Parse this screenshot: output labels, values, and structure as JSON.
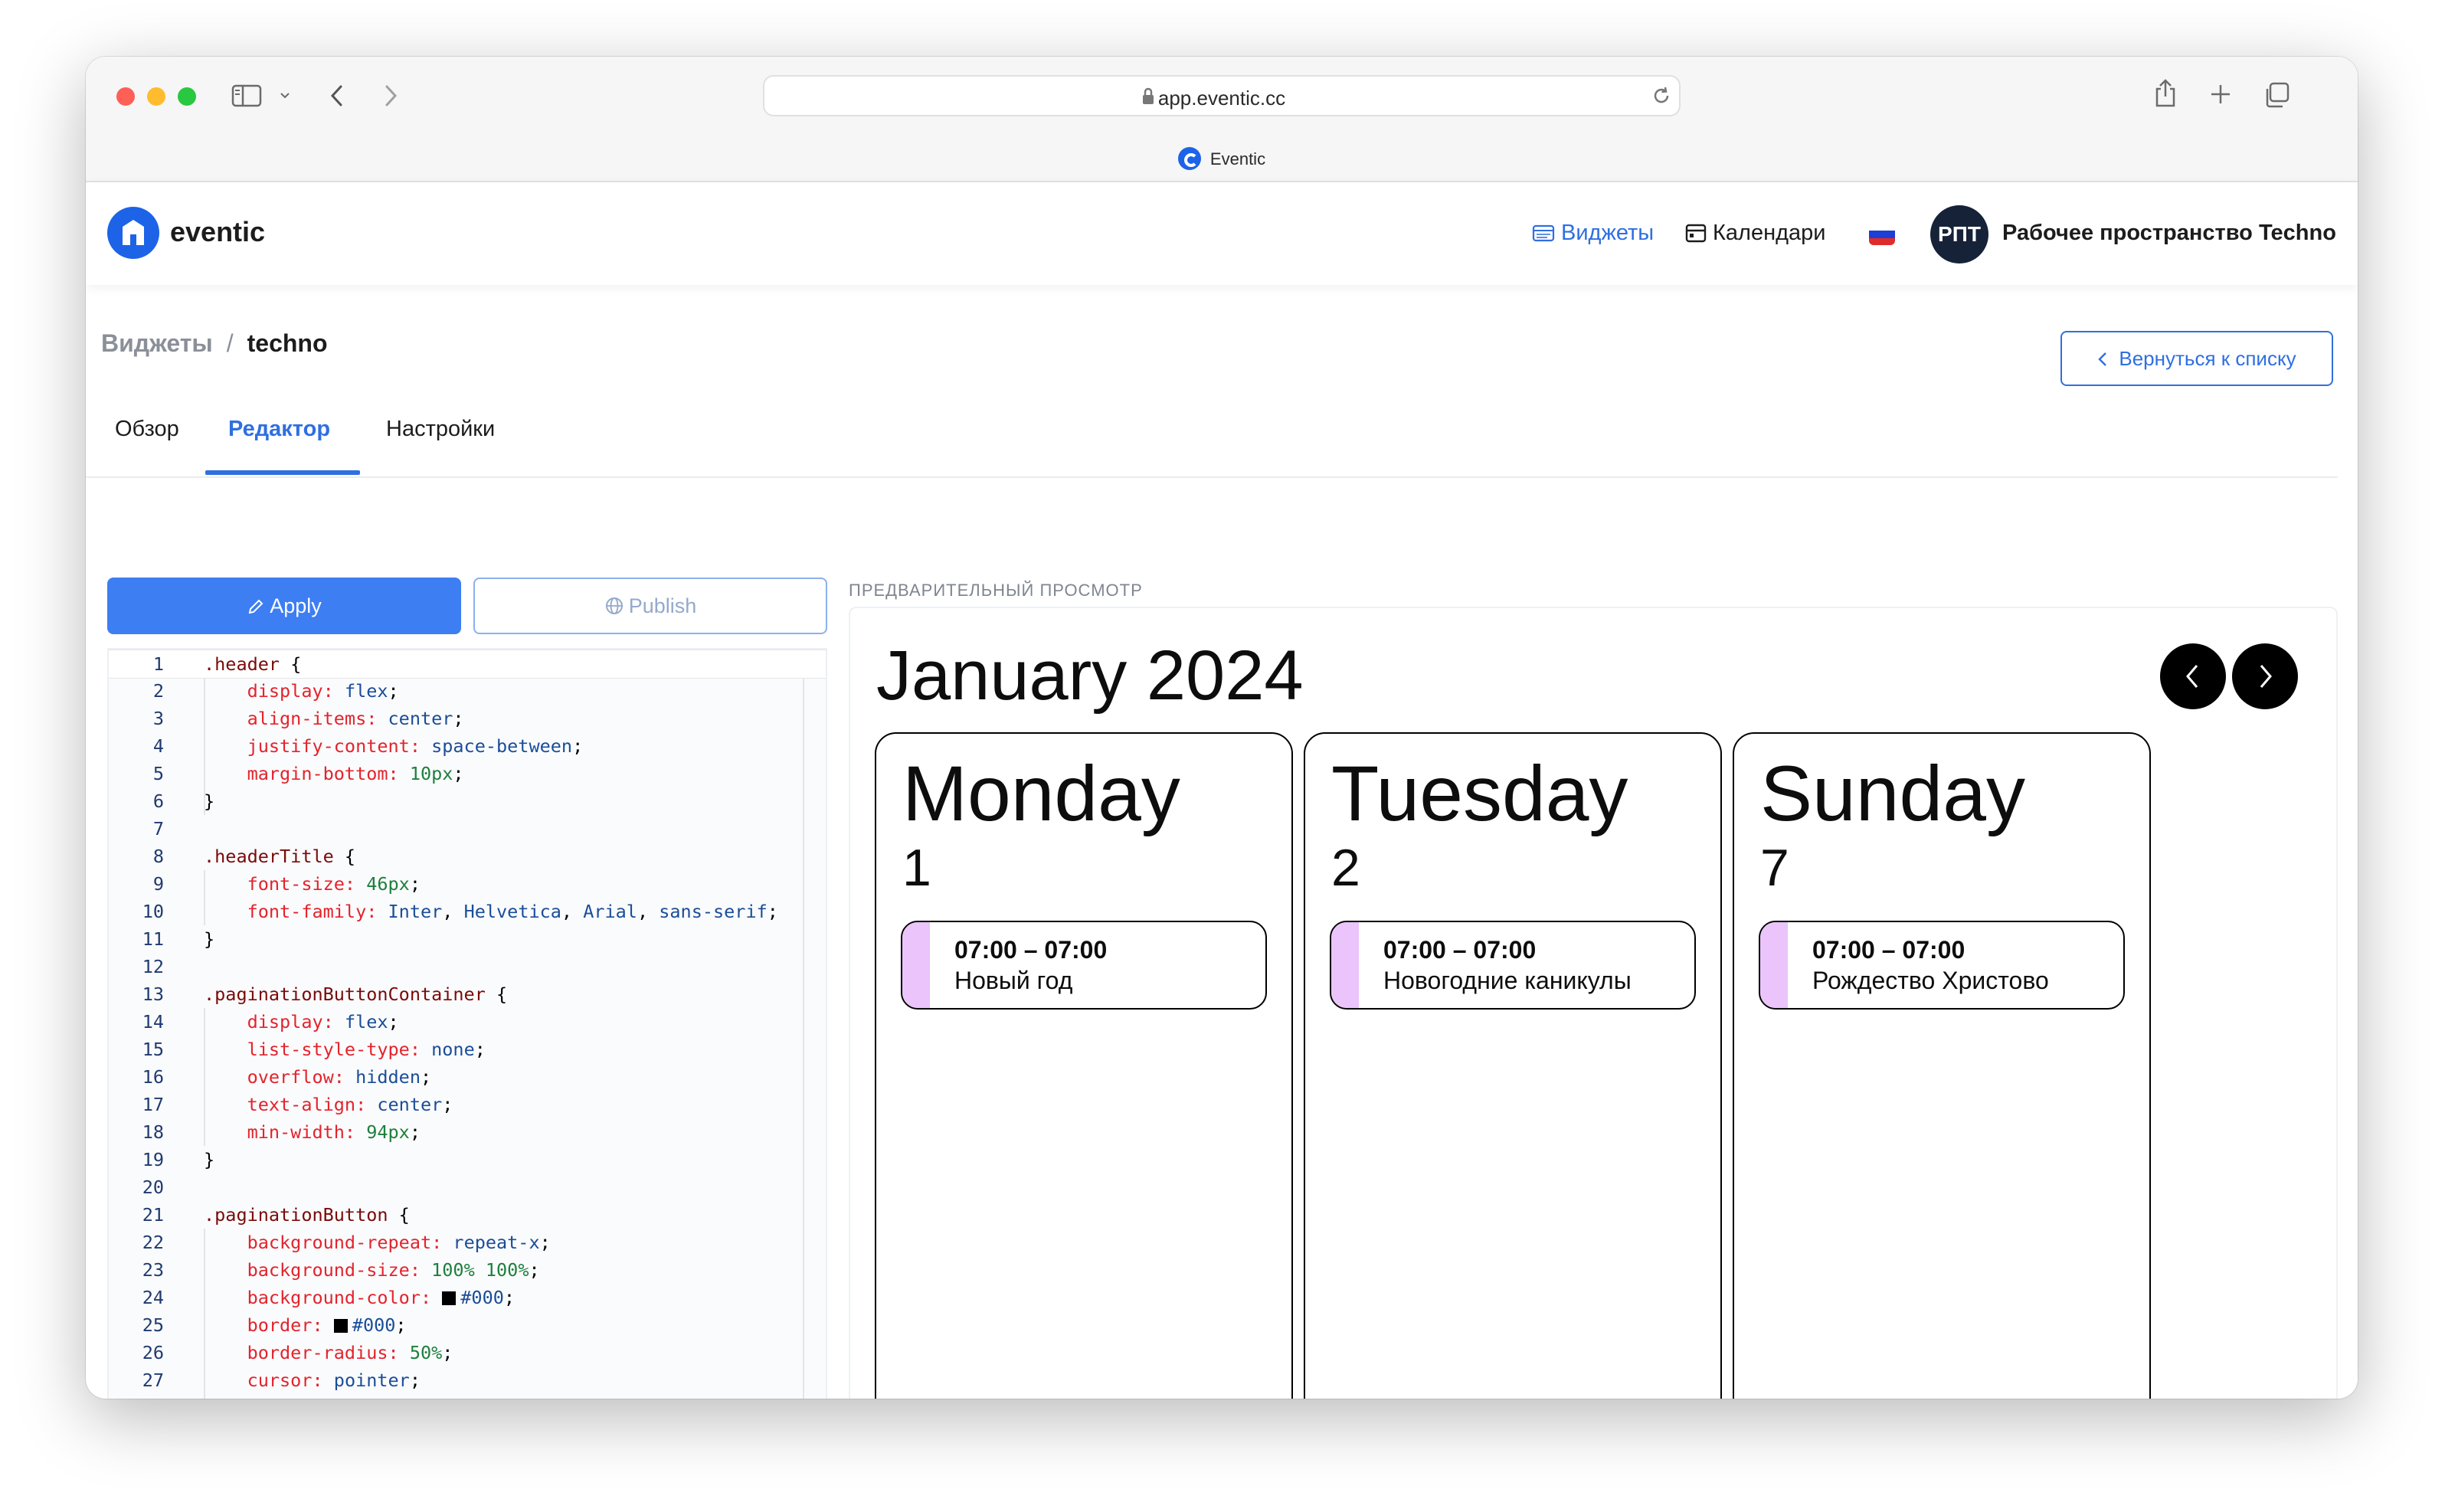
{
  "browser": {
    "url": "app.eventic.cc",
    "tab_title": "Eventic"
  },
  "app": {
    "logo_text": "eventic",
    "nav": {
      "widgets": "Виджеты",
      "calendars": "Календари"
    },
    "workspace": {
      "avatar_initials": "РПТ",
      "name": "Рабочее пространство Techno"
    }
  },
  "breadcrumb": {
    "root": "Виджеты",
    "separator": "/",
    "current": "techno"
  },
  "back_button": "Вернуться к списку",
  "tabs": [
    "Обзор",
    "Редактор",
    "Настройки"
  ],
  "active_tab": "Редактор",
  "editor": {
    "apply_label": "Apply",
    "publish_label": "Publish",
    "language": "css"
  },
  "preview": {
    "label": "ПРЕДВАРИТЕЛЬНЫЙ ПРОСМОТР",
    "month": "January 2024",
    "days": [
      {
        "name": "Monday",
        "number": "1",
        "event": {
          "time": "07:00 – 07:00",
          "title": "Новый год"
        }
      },
      {
        "name": "Tuesday",
        "number": "2",
        "event": {
          "time": "07:00 – 07:00",
          "title": "Новогодние каникулы"
        }
      },
      {
        "name": "Sunday",
        "number": "7",
        "event": {
          "time": "07:00 – 07:00",
          "title": "Рождество Христово"
        }
      }
    ]
  },
  "colors": {
    "accent": "#2f6fe0",
    "apply_button": "#3d7ef2",
    "event_bar": "#ebc4fb",
    "avatar_bg": "#152238"
  }
}
